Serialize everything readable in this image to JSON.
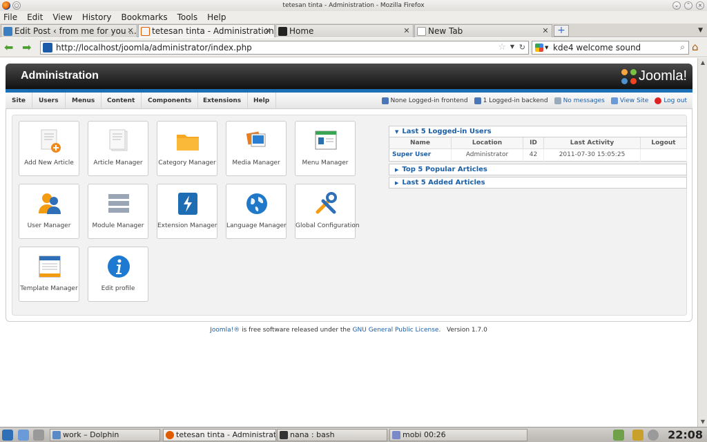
{
  "window": {
    "title": "tetesan tinta - Administration - Mozilla Firefox"
  },
  "menubar": {
    "items": [
      "File",
      "Edit",
      "View",
      "History",
      "Bookmarks",
      "Tools",
      "Help"
    ]
  },
  "tabs": [
    {
      "label": "Edit Post ‹ from me for you ...",
      "active": false
    },
    {
      "label": "tetesan tinta - Administration",
      "active": true
    },
    {
      "label": "Home",
      "active": false
    },
    {
      "label": "New Tab",
      "active": false
    }
  ],
  "nav": {
    "url": "http://localhost/joomla/administrator/index.php",
    "search": "kde4 welcome sound"
  },
  "admin": {
    "title": "Administration",
    "logo": "Joomla!",
    "menu": [
      "Site",
      "Users",
      "Menus",
      "Content",
      "Components",
      "Extensions",
      "Help"
    ],
    "status": {
      "frontend": "None Logged-in frontend",
      "backend": "1 Logged-in backend",
      "messages": "No messages",
      "view_site": "View Site",
      "logout": "Log out"
    }
  },
  "quickicons": [
    {
      "label": "Add New Article",
      "icon": "add-article-icon"
    },
    {
      "label": "Article Manager",
      "icon": "article-icon"
    },
    {
      "label": "Category Manager",
      "icon": "folder-icon"
    },
    {
      "label": "Media Manager",
      "icon": "media-icon"
    },
    {
      "label": "Menu Manager",
      "icon": "menu-icon"
    },
    {
      "label": "User Manager",
      "icon": "user-icon"
    },
    {
      "label": "Module Manager",
      "icon": "module-icon"
    },
    {
      "label": "Extension Manager",
      "icon": "extension-icon"
    },
    {
      "label": "Language Manager",
      "icon": "globe-icon"
    },
    {
      "label": "Global Configuration",
      "icon": "tools-icon"
    },
    {
      "label": "Template Manager",
      "icon": "template-icon"
    },
    {
      "label": "Edit profile",
      "icon": "info-icon"
    }
  ],
  "panes": {
    "logged_in": {
      "title": "Last 5 Logged-in Users",
      "columns": [
        "Name",
        "Location",
        "ID",
        "Last Activity",
        "Logout"
      ],
      "rows": [
        {
          "name": "Super User",
          "location": "Administrator",
          "id": "42",
          "activity": "2011-07-30 15:05:25",
          "logout": ""
        }
      ]
    },
    "popular": {
      "title": "Top 5 Popular Articles"
    },
    "added": {
      "title": "Last 5 Added Articles"
    }
  },
  "footer": {
    "joomla": "Joomla!®",
    "text1": " is free software released under the ",
    "license": "GNU General Public License",
    "text2": ".",
    "version": "Version 1.7.0"
  },
  "taskbar": {
    "items": [
      "work – Dolphin",
      "tetesan tinta - Administration - M",
      "nana : bash",
      "mobi 00:26"
    ],
    "clock": "22:08"
  }
}
